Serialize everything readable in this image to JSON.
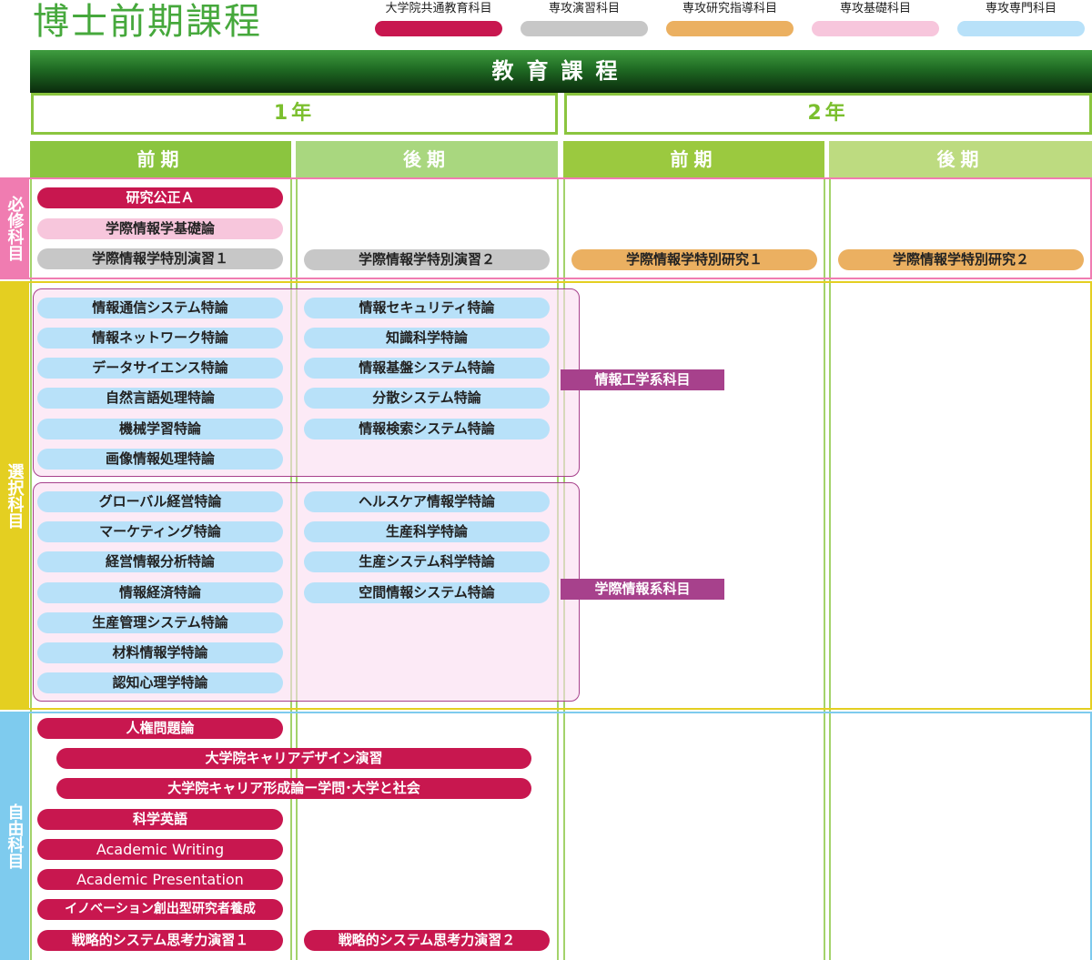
{
  "title": "博士前期課程",
  "legend": [
    {
      "label": "大学院共通教育科目",
      "color": "#c8174f"
    },
    {
      "label": "専攻演習科目",
      "color": "#c7c7c7"
    },
    {
      "label": "専攻研究指導科目",
      "color": "#ebb061"
    },
    {
      "label": "専攻基礎科目",
      "color": "#f7c6dc"
    },
    {
      "label": "専攻専門科目",
      "color": "#b8e1f9"
    }
  ],
  "header": "教育課程",
  "years": [
    "1年",
    "2年"
  ],
  "terms": [
    "前期",
    "後期",
    "前期",
    "後期"
  ],
  "sections": {
    "required": {
      "label": "必修科目",
      "courses": {
        "research_fairness": "研究公正Ａ",
        "basic_theory": "学際情報学基礎論",
        "seminar1": "学際情報学特別演習１",
        "seminar2": "学際情報学特別演習２",
        "research1": "学際情報学特別研究１",
        "research2": "学際情報学特別研究２"
      }
    },
    "elective": {
      "label": "選択科目",
      "groups": [
        {
          "label": "情報工学系科目",
          "first_term": [
            "情報通信システム特論",
            "情報ネットワーク特論",
            "データサイエンス特論",
            "自然言語処理特論",
            "機械学習特論",
            "画像情報処理特論"
          ],
          "second_term": [
            "情報セキュリティ特論",
            "知識科学特論",
            "情報基盤システム特論",
            "分散システム特論",
            "情報検索システム特論"
          ]
        },
        {
          "label": "学際情報系科目",
          "first_term": [
            "グローバル経営特論",
            "マーケティング特論",
            "経営情報分析特論",
            "情報経済特論",
            "生産管理システム特論",
            "材料情報学特論",
            "認知心理学特論"
          ],
          "second_term": [
            "ヘルスケア情報学特論",
            "生産科学特論",
            "生産システム科学特論",
            "空間情報システム特論"
          ]
        }
      ]
    },
    "free": {
      "label": "自由科目",
      "courses": {
        "human_rights": "人権問題論",
        "career_design": "大学院キャリアデザイン演習",
        "career_formation": "大学院キャリア形成論ー学問･大学と社会",
        "sci_english": "科学英語",
        "writing": "Academic Writing",
        "presentation": "Academic Presentation",
        "innovation": "イノベーション創出型研究者養成",
        "strategy1": "戦略的システム思考力演習１",
        "strategy2": "戦略的システム思考力演習２"
      }
    }
  },
  "colors": {
    "required": "#f07cb1",
    "elective": "#e4cf21",
    "free": "#7ecbee",
    "term1": "#8bc53f",
    "term2": "#a9d77f",
    "term3": "#9bc93f",
    "term4": "#bddb80"
  }
}
